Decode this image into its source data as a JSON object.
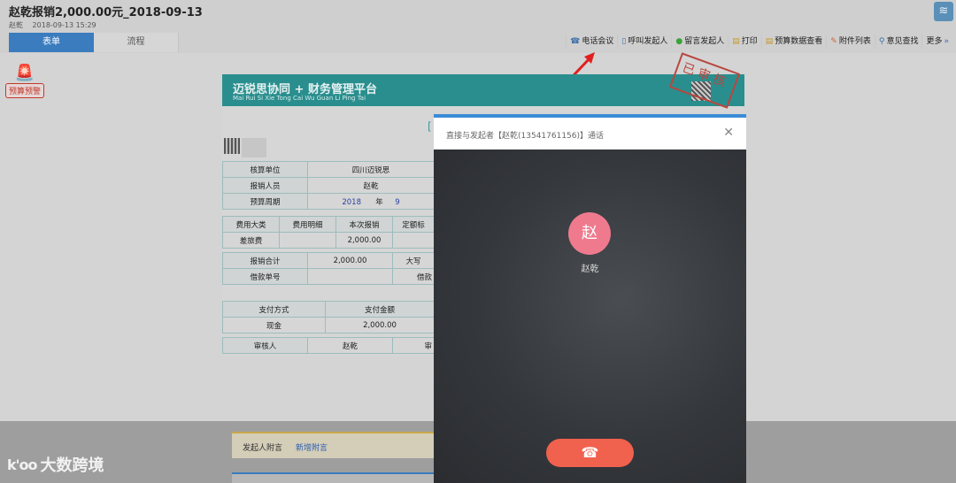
{
  "header": {
    "title": "赵乾报销2,000.00元_2018-09-13",
    "author": "赵乾",
    "datetime": "2018-09-13 15:29"
  },
  "tabs": [
    {
      "label": "表单",
      "active": true
    },
    {
      "label": "流程",
      "active": false
    }
  ],
  "toolbar": [
    {
      "icon": "phone-conference-icon",
      "label": "电话会议"
    },
    {
      "icon": "call-icon",
      "label": "呼叫发起人"
    },
    {
      "icon": "message-icon",
      "label": "留言发起人"
    },
    {
      "icon": "print-icon",
      "label": "打印"
    },
    {
      "icon": "budget-icon",
      "label": "预算数据查看"
    },
    {
      "icon": "attachment-icon",
      "label": "附件列表"
    },
    {
      "icon": "search-icon",
      "label": "意见查找"
    },
    {
      "icon": "more-icon",
      "label": "更多"
    }
  ],
  "alarm": {
    "label": "预算预警",
    "icon": "siren-icon"
  },
  "document": {
    "banner_title": "迈锐思协同 + 财务管理平台",
    "banner_subtitle": "Mai Rui Si Xie Tong Cai Wu Guan Li Ping Tai",
    "stamp_text": "已 审 核",
    "rows": {
      "unit_label": "核算单位",
      "unit_value": "四川迈锐思",
      "person_label": "报销人员",
      "person_value": "赵乾",
      "period_label": "预算周期",
      "period_year": "2018",
      "period_year_unit": "年",
      "period_month": "9",
      "cost_cat_label": "费用大类",
      "cost_detail_label": "费用明细",
      "amount_label": "本次报销",
      "quota_label": "定额标",
      "cost_cat_value": "差旅费",
      "amount_value": "2,000.00",
      "total_label": "报销合计",
      "total_value": "2,000.00",
      "capital_label": "大写",
      "loan_label": "借款单号",
      "loan_right_label": "借款",
      "pay_method_label": "支付方式",
      "pay_amount_label": "支付金额",
      "pay_method_value": "现金",
      "pay_amount_value": "2,000.00",
      "reviewer_label": "审核人",
      "reviewer_value": "赵乾",
      "reviewer_right_label": "审"
    }
  },
  "call_modal": {
    "title": "直接与发起者【赵乾(13541761156)】通话",
    "avatar_char": "赵",
    "caller_name": "赵乾",
    "hangup_icon": "☎"
  },
  "attachments": {
    "label": "发起人附言",
    "link": "新增附言"
  },
  "watermark": {
    "logo": "k'oo",
    "text": "大数跨境"
  },
  "colors": {
    "accent": "#3b7cbf",
    "banner": "#2a8e8e",
    "hangup": "#f0614e",
    "avatar": "#ef7a8e"
  }
}
